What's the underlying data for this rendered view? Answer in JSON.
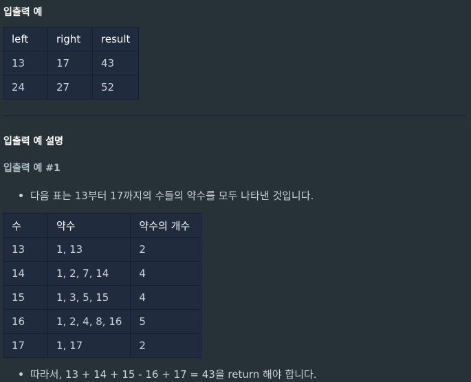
{
  "section1": {
    "heading": "입출력 예",
    "table": {
      "headers": [
        "left",
        "right",
        "result"
      ],
      "rows": [
        [
          "13",
          "17",
          "43"
        ],
        [
          "24",
          "27",
          "52"
        ]
      ]
    }
  },
  "section2": {
    "heading": "입출력 예 설명",
    "subheading": "입출력 예 #1",
    "bullet1": "다음 표는 13부터 17까지의 수들의 약수를 모두 나타낸 것입니다.",
    "table": {
      "headers": [
        "수",
        "약수",
        "약수의 개수"
      ],
      "rows": [
        [
          "13",
          "1, 13",
          "2"
        ],
        [
          "14",
          "1, 2, 7, 14",
          "4"
        ],
        [
          "15",
          "1, 3, 5, 15",
          "4"
        ],
        [
          "16",
          "1, 2, 4, 8, 16",
          "5"
        ],
        [
          "17",
          "1, 17",
          "2"
        ]
      ]
    },
    "bullet2": "따라서, 13 + 14 + 15 - 16 + 17 = 43을 return 해야 합니다."
  }
}
